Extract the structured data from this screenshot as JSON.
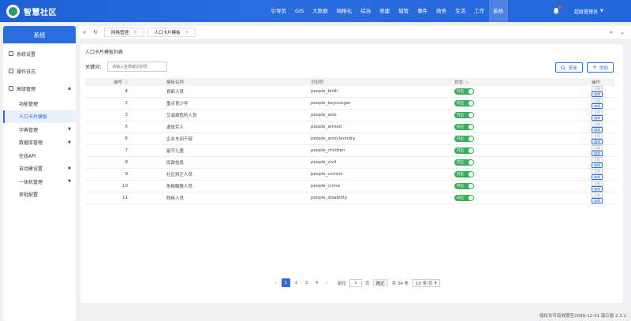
{
  "app": {
    "title": "智慧社区"
  },
  "topnav": [
    {
      "label": "引导页"
    },
    {
      "label": "GIS"
    },
    {
      "label": "大数据"
    },
    {
      "label": "网格化"
    },
    {
      "label": "综治"
    },
    {
      "label": "党建"
    },
    {
      "label": "城管"
    },
    {
      "label": "事件"
    },
    {
      "label": "政务"
    },
    {
      "label": "生活"
    },
    {
      "label": "工作"
    },
    {
      "label": "系统"
    }
  ],
  "user": {
    "name": "超级管理员"
  },
  "sidebar": {
    "title": "系统",
    "items": [
      {
        "label": "系统设置"
      },
      {
        "label": "操作日志"
      },
      {
        "label": "高级管理"
      }
    ],
    "subs": [
      {
        "label": "功能管理"
      },
      {
        "label": "人口卡片模板"
      },
      {
        "label": "字典管理"
      },
      {
        "label": "数据库管理"
      },
      {
        "label": "在线API"
      },
      {
        "label": "自动建设置"
      },
      {
        "label": "一体机管理"
      },
      {
        "label": "审批配置"
      }
    ]
  },
  "tabs": [
    {
      "label": "网格管理"
    },
    {
      "label": "人口卡片模板"
    }
  ],
  "main": {
    "title": "人口卡片模板列表",
    "search_label": "关键词：",
    "search_placeholder": "请输入名称或识别符",
    "query_label": "查询",
    "add_label": "添加",
    "columns": [
      "编号",
      "模板名称",
      "识别符",
      "状态",
      "操作"
    ],
    "rows": [
      {
        "idx": "4",
        "name": "育龄人员",
        "id": "people_birth",
        "state": "开启"
      },
      {
        "idx": "2",
        "name": "重点青少年",
        "id": "people_keyounger",
        "state": "开启"
      },
      {
        "idx": "3",
        "name": "艾滋病危险人员",
        "id": "people_aids",
        "state": "开启"
      },
      {
        "idx": "5",
        "name": "退役军人",
        "id": "people_armed",
        "state": "开启"
      },
      {
        "idx": "6",
        "name": "企业车间干部",
        "id": "people_armylaundry",
        "state": "开启"
      },
      {
        "idx": "7",
        "name": "留守儿童",
        "id": "people_children",
        "state": "开启"
      },
      {
        "idx": "8",
        "name": "民政信息",
        "id": "people_civil",
        "state": "开启"
      },
      {
        "idx": "9",
        "name": "社区矫正人员",
        "id": "people_correct",
        "state": "开启"
      },
      {
        "idx": "10",
        "name": "刑释解教人员",
        "id": "people_crime",
        "state": "开启"
      },
      {
        "idx": "11",
        "name": "残疾人员",
        "id": "people_disability",
        "state": "开启"
      }
    ],
    "op_view": "详情",
    "op_edit": "编辑"
  },
  "pager": {
    "pages": [
      "1",
      "2",
      "3",
      "4"
    ],
    "goto_prefix": "前往",
    "goto_value": "1",
    "goto_suffix": "页",
    "confirm": "确定",
    "total": "共 34 条",
    "size": "10 条/页"
  },
  "footer": {
    "text": "授权许可有效期至2099-12-31 演示版  2.3.1"
  },
  "colors": {
    "primary": "#2b6de0",
    "switch_on": "#38b15a"
  }
}
